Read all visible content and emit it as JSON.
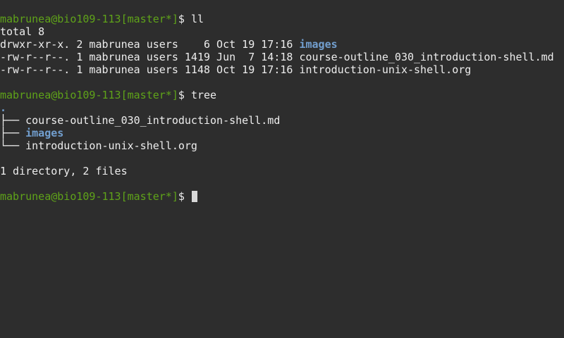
{
  "terminal": {
    "prompt": "mabrunea@bio109-113[master*]",
    "prompt_symbol": "$",
    "cmd1": "ll",
    "total": "total 8",
    "listing": [
      {
        "meta": "drwxr-xr-x. 2 mabrunea users    6 Oct 19 17:16 ",
        "name": "images"
      },
      {
        "meta": "-rw-r--r--. 1 mabrunea users 1419 Jun  7 14:18 ",
        "name": "course-outline_030_introduction-shell.md"
      },
      {
        "meta": "-rw-r--r--. 1 mabrunea users 1148 Oct 19 17:16 ",
        "name": "introduction-unix-shell.org"
      }
    ],
    "cmd2": "tree",
    "tree_root": ".",
    "tree": [
      {
        "branch": "├── ",
        "name": "course-outline_030_introduction-shell.md"
      },
      {
        "branch": "├── ",
        "name": "images"
      },
      {
        "branch": "└── ",
        "name": "introduction-unix-shell.org"
      }
    ],
    "summary": "1 directory, 2 files"
  }
}
